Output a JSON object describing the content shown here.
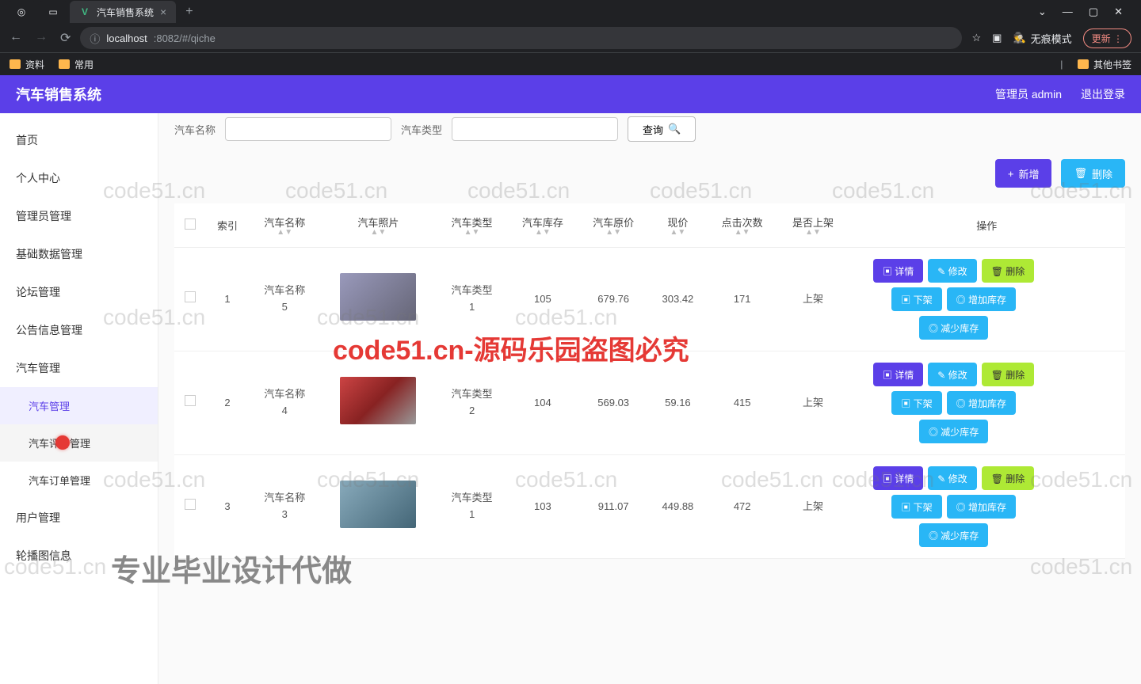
{
  "browser": {
    "tab_title": "汽车销售系统",
    "url_prefix": "localhost",
    "url_rest": ":8082/#/qiche",
    "incognito": "无痕模式",
    "update": "更新",
    "bookmark1": "资料",
    "bookmark2": "常用",
    "other_bookmarks": "其他书签"
  },
  "header": {
    "title": "汽车销售系统",
    "admin": "管理员 admin",
    "logout": "退出登录"
  },
  "sidebar": {
    "items": [
      {
        "label": "首页"
      },
      {
        "label": "个人中心"
      },
      {
        "label": "管理员管理"
      },
      {
        "label": "基础数据管理"
      },
      {
        "label": "论坛管理"
      },
      {
        "label": "公告信息管理"
      },
      {
        "label": "汽车管理"
      },
      {
        "label": "汽车管理",
        "sub": true,
        "active": true
      },
      {
        "label": "汽车评价管理",
        "sub": true,
        "hover": true
      },
      {
        "label": "汽车订单管理",
        "sub": true
      },
      {
        "label": "用户管理"
      },
      {
        "label": "轮播图信息"
      }
    ]
  },
  "search": {
    "label1": "汽车名称",
    "label2": "汽车类型",
    "btn": "查询"
  },
  "actions": {
    "add": "新增",
    "delete": "删除"
  },
  "table": {
    "headers": [
      "索引",
      "汽车名称",
      "汽车照片",
      "汽车类型",
      "汽车库存",
      "汽车原价",
      "现价",
      "点击次数",
      "是否上架",
      "操作"
    ],
    "rows": [
      {
        "idx": "1",
        "name": "汽车名称5",
        "type": "汽车类型1",
        "stock": "105",
        "orig": "679.76",
        "now": "303.42",
        "clicks": "171",
        "status": "上架"
      },
      {
        "idx": "2",
        "name": "汽车名称4",
        "type": "汽车类型2",
        "stock": "104",
        "orig": "569.03",
        "now": "59.16",
        "clicks": "415",
        "status": "上架"
      },
      {
        "idx": "3",
        "name": "汽车名称3",
        "type": "汽车类型1",
        "stock": "103",
        "orig": "911.07",
        "now": "449.88",
        "clicks": "472",
        "status": "上架"
      }
    ],
    "ops": {
      "detail": "详情",
      "edit": "修改",
      "del": "删除",
      "off": "下架",
      "inc": "增加库存",
      "dec": "减少库存"
    }
  },
  "watermarks": {
    "code51": "code51.cn",
    "red": "code51.cn-源码乐园盗图必究",
    "gray": "专业毕业设计代做"
  }
}
